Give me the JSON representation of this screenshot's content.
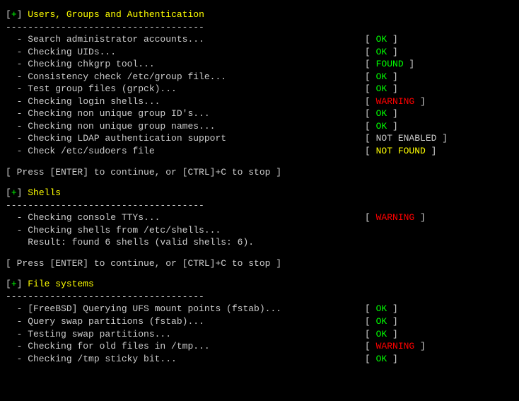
{
  "sections": [
    {
      "title": "Users, Groups and Authentication",
      "divider": "------------------------------------",
      "items": [
        {
          "desc": "  - Search administrator accounts...",
          "status": "OK",
          "cls": "ok"
        },
        {
          "desc": "  - Checking UIDs...",
          "status": "OK",
          "cls": "ok"
        },
        {
          "desc": "  - Checking chkgrp tool...",
          "status": "FOUND",
          "cls": "found"
        },
        {
          "desc": "  - Consistency check /etc/group file...",
          "status": "OK",
          "cls": "ok"
        },
        {
          "desc": "  - Test group files (grpck)...",
          "status": "OK",
          "cls": "ok"
        },
        {
          "desc": "  - Checking login shells...",
          "status": "WARNING",
          "cls": "warning"
        },
        {
          "desc": "  - Checking non unique group ID's...",
          "status": "OK",
          "cls": "ok"
        },
        {
          "desc": "  - Checking non unique group names...",
          "status": "OK",
          "cls": "ok"
        },
        {
          "desc": "  - Checking LDAP authentication support",
          "status": "NOT ENABLED",
          "cls": "notenabled"
        },
        {
          "desc": "  - Check /etc/sudoers file",
          "status": "NOT FOUND",
          "cls": "notfound"
        }
      ],
      "prompt": "[ Press [ENTER] to continue, or [CTRL]+C to stop ]"
    },
    {
      "title": "Shells",
      "divider": "------------------------------------",
      "items": [
        {
          "desc": "  - Checking console TTYs...",
          "status": "WARNING",
          "cls": "warning"
        },
        {
          "desc": "  - Checking shells from /etc/shells...",
          "status": null,
          "cls": null
        },
        {
          "desc": "    Result: found 6 shells (valid shells: 6).",
          "status": null,
          "cls": null
        }
      ],
      "prompt": "[ Press [ENTER] to continue, or [CTRL]+C to stop ]"
    },
    {
      "title": "File systems",
      "divider": "------------------------------------",
      "items": [
        {
          "desc": "  - [FreeBSD] Querying UFS mount points (fstab)...",
          "status": "OK",
          "cls": "ok"
        },
        {
          "desc": "  - Query swap partitions (fstab)...",
          "status": "OK",
          "cls": "ok"
        },
        {
          "desc": "  - Testing swap partitions...",
          "status": "OK",
          "cls": "ok"
        },
        {
          "desc": "  - Checking for old files in /tmp...",
          "status": "WARNING",
          "cls": "warning"
        },
        {
          "desc": "  - Checking /tmp sticky bit...",
          "status": "OK",
          "cls": "ok"
        }
      ],
      "prompt": null
    }
  ],
  "section_prefix_open": "[",
  "section_prefix_plus": "+",
  "section_prefix_close": "] ",
  "status_open": "[ ",
  "status_close": " ]"
}
